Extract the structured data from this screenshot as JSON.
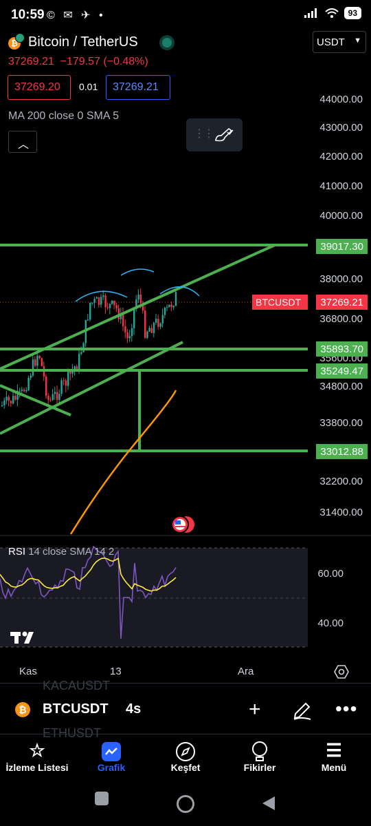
{
  "status": {
    "time": "10:59",
    "battery": "93",
    "apps": "© ✉ ✈ •"
  },
  "header": {
    "title": "Bitcoin / TetherUS",
    "currency": "USDT",
    "last": "37269.21",
    "change": "−179.57 (−0.48%)"
  },
  "quote": {
    "bid": "37269.20",
    "spread": "0.01",
    "ask": "37269.21"
  },
  "indicator": {
    "ma": "MA 200 close 0 SMA 5"
  },
  "price_axis": [
    "44000.00",
    "43000.00",
    "42000.00",
    "41000.00",
    "40000.00",
    "38000.00",
    "36800.00",
    "35600.00",
    "34800.00",
    "33800.00",
    "32200.00",
    "31400.00"
  ],
  "price_boxes": {
    "b1": "39017.30",
    "b2": "35893.70",
    "b3": "35249.47",
    "b4": "33012.88",
    "current": "37269.21",
    "symbol_tag": "BTCUSDT"
  },
  "rsi": {
    "name": "RSI",
    "params": "14 close SMA 14 2",
    "level_hi": "60.00",
    "level_lo": "40.00"
  },
  "time_axis": {
    "t1": "Kas",
    "t2": "13",
    "t3": "Ara"
  },
  "symbol_bar": {
    "symbol": "BTCUSDT",
    "timeframe": "4s",
    "ghost_top": "KACAUSDT",
    "ghost_bottom": "ETHUSDT"
  },
  "nav": [
    {
      "label": "İzleme Listesi",
      "icon": "star-icon"
    },
    {
      "label": "Grafik",
      "icon": "chart-icon"
    },
    {
      "label": "Keşfet",
      "icon": "compass-icon"
    },
    {
      "label": "Fikirler",
      "icon": "bulb-icon"
    },
    {
      "label": "Menü",
      "icon": "menu-icon"
    }
  ],
  "colors": {
    "up": "#26a69a",
    "down": "#f23645",
    "trend": "#4caf50",
    "ma": "#ff9800",
    "rsi": "#7e57c2",
    "accent": "#2962ff"
  }
}
